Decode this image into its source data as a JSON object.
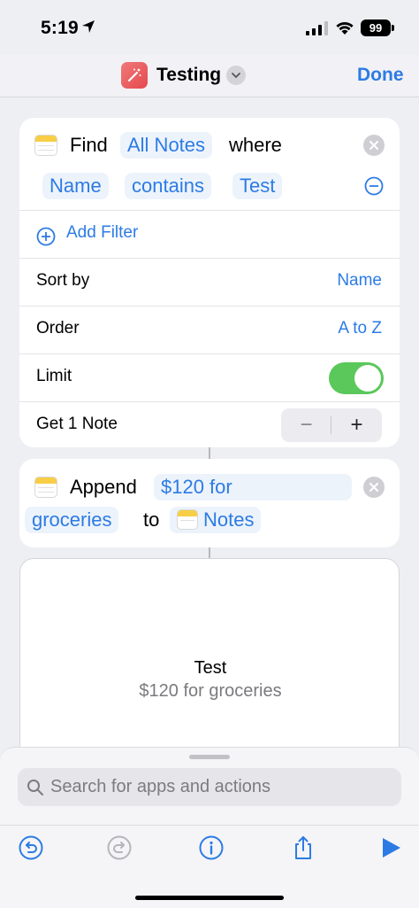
{
  "status_bar": {
    "time": "5:19",
    "battery": "99"
  },
  "navbar": {
    "title": "Testing",
    "done_label": "Done"
  },
  "find_action": {
    "verb": "Find",
    "source": "All Notes",
    "where": "where",
    "filter": {
      "field": "Name",
      "operator": "contains",
      "value": "Test"
    },
    "add_filter_label": "Add Filter",
    "sort_by": {
      "label": "Sort by",
      "value": "Name"
    },
    "order": {
      "label": "Order",
      "value": "A to Z"
    },
    "limit": {
      "label": "Limit",
      "enabled": true
    },
    "get": {
      "label": "Get 1 Note",
      "count": 1
    }
  },
  "append_action": {
    "verb": "Append",
    "text_part1": "$120 for",
    "text_part2": "groceries",
    "to": "to",
    "target": "Notes"
  },
  "preview": {
    "title": "Test",
    "subtitle": "$120 for groceries"
  },
  "search": {
    "placeholder": "Search for apps and actions"
  },
  "toolbar": [
    "undo-icon",
    "redo-icon",
    "info-icon",
    "share-icon",
    "play-icon"
  ],
  "colors": {
    "accent": "#2c7be5",
    "toggle_on": "#5ac85a",
    "notes_yellow": "#f7ce46",
    "app_icon": "#e5484d"
  }
}
